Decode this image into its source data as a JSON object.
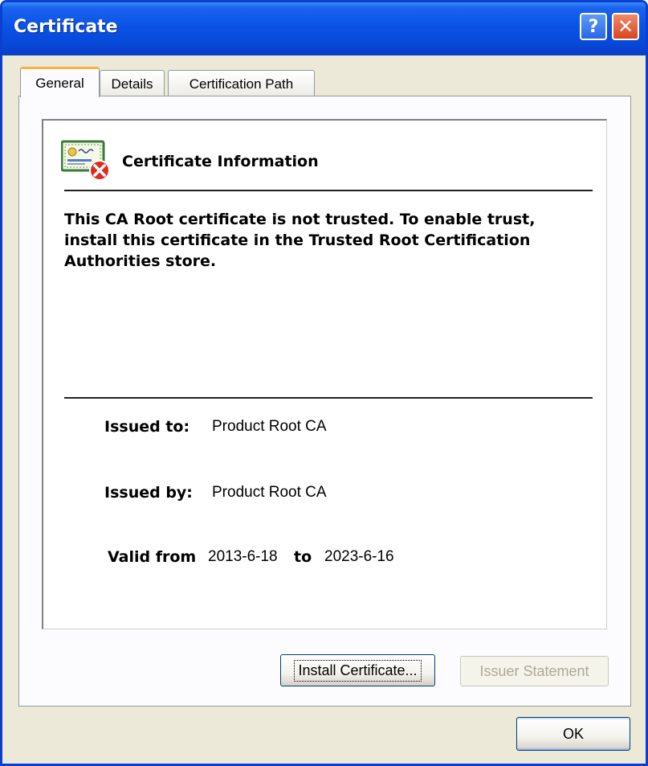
{
  "window": {
    "title": "Certificate",
    "help_button": "?",
    "close_button": "✕"
  },
  "tabs": [
    {
      "label": "General",
      "selected": true
    },
    {
      "label": "Details",
      "selected": false
    },
    {
      "label": "Certification Path",
      "selected": false
    }
  ],
  "info": {
    "heading": "Certificate Information",
    "icon": "certificate-error-icon",
    "warning": "This CA Root certificate is not trusted. To enable trust,\ninstall this certificate in the Trusted Root Certification\nAuthorities store.",
    "issued_to_label": "Issued to:",
    "issued_to_value": "Product Root CA",
    "issued_by_label": "Issued by:",
    "issued_by_value": "Product Root CA",
    "valid_from_label": "Valid from",
    "valid_from_value": "2013-6-18",
    "valid_to_label": "to",
    "valid_to_value": "2023-6-16"
  },
  "buttons": {
    "install_certificate": {
      "label": "Install Certificate...",
      "enabled": true
    },
    "issuer_statement": {
      "label": "Issuer Statement",
      "enabled": false
    },
    "ok": {
      "label": "OK",
      "enabled": true
    }
  },
  "colors": {
    "titlebar": "#0a52e4",
    "dialog_background": "#ece9d8",
    "close_button": "#d8451e",
    "selected_tab_accent": "#f7b240"
  }
}
